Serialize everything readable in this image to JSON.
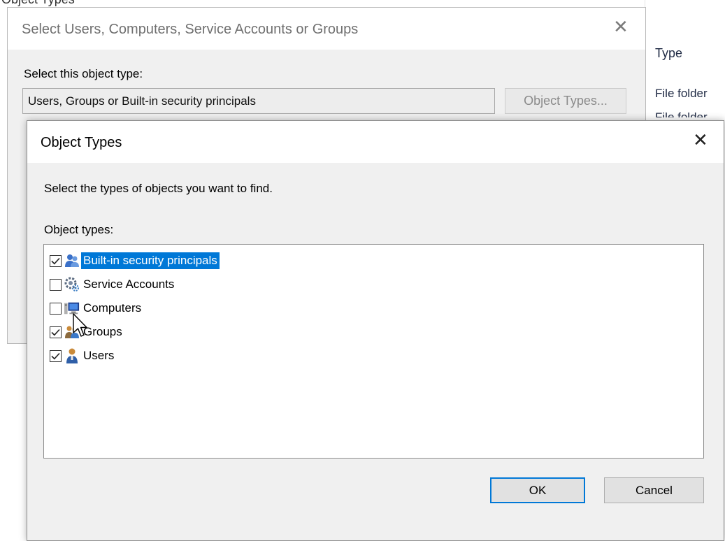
{
  "top_crop_text": "Object Types",
  "back_dialog": {
    "title": "Select Users, Computers, Service Accounts or Groups",
    "object_type_label": "Select this object type:",
    "object_type_value": "Users, Groups or Built-in security principals",
    "object_types_button": "Object Types..."
  },
  "background": {
    "column_header": "Type",
    "row1": "File folder",
    "row2": "File folder"
  },
  "dialog": {
    "title": "Object Types",
    "prompt": "Select the types of objects you want to find.",
    "list_label": "Object types:",
    "items": [
      {
        "label": "Built-in security principals",
        "checked": true,
        "selected": true,
        "icon": "security-principals-icon"
      },
      {
        "label": "Service Accounts",
        "checked": false,
        "selected": false,
        "icon": "service-account-icon"
      },
      {
        "label": "Computers",
        "checked": false,
        "selected": false,
        "icon": "computer-icon"
      },
      {
        "label": "Groups",
        "checked": true,
        "selected": false,
        "icon": "group-icon"
      },
      {
        "label": "Users",
        "checked": true,
        "selected": false,
        "icon": "user-icon"
      }
    ],
    "ok_label": "OK",
    "cancel_label": "Cancel"
  },
  "colors": {
    "selection": "#0078d7",
    "dialog_bg": "#f0f0f0"
  }
}
